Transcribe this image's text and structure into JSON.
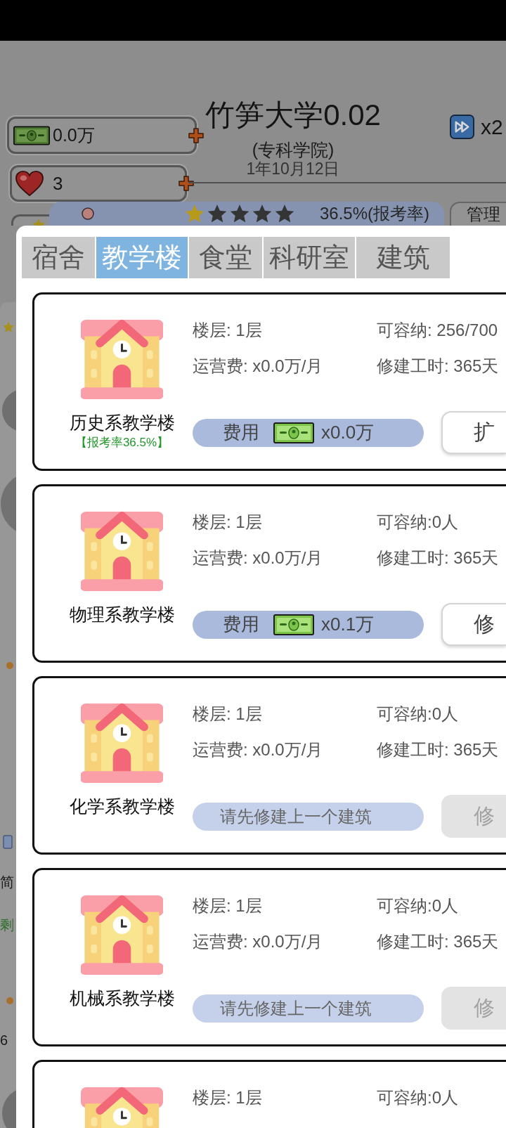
{
  "header": {
    "money": "0.0万",
    "hearts": "3",
    "title": "竹笋大学0.02",
    "subtitle": "(专科学院)",
    "date": "1年10月12日",
    "speed": "x2"
  },
  "rating_bar": {
    "stars": 1,
    "rate": "36.5%(报考率)"
  },
  "manage_button": {
    "label": "管理"
  },
  "left_strip": {
    "texts": [
      {
        "text": "简",
        "kind": "plain"
      },
      {
        "text": "剩",
        "kind": "highlight"
      },
      {
        "text": "6",
        "kind": "plain"
      }
    ]
  },
  "dialog": {
    "tabs": [
      {
        "label": "宿舍",
        "selected": false
      },
      {
        "label": "教学楼",
        "selected": true
      },
      {
        "label": "食堂",
        "selected": false
      },
      {
        "label": "科研室",
        "selected": false
      },
      {
        "label": "建筑",
        "selected": false
      }
    ],
    "buildings": [
      {
        "name": "历史系教学楼",
        "note": "【报考率36.5%】",
        "floors": "楼层: 1层",
        "capacity": "可容纳: 256/700",
        "upkeep": "运营费: x0.0万/月",
        "build_time": "修建工时: 365天",
        "cost": {
          "kind": "price",
          "label": "费用",
          "amount": "x0.0万"
        },
        "button": {
          "label": "扩",
          "disabled": false
        }
      },
      {
        "name": "物理系教学楼",
        "floors": "楼层: 1层",
        "capacity": "可容纳:0人",
        "upkeep": "运营费: x0.0万/月",
        "build_time": "修建工时: 365天",
        "cost": {
          "kind": "price",
          "label": "费用",
          "amount": "x0.1万"
        },
        "button": {
          "label": "修",
          "disabled": false
        }
      },
      {
        "name": "化学系教学楼",
        "floors": "楼层: 1层",
        "capacity": "可容纳:0人",
        "upkeep": "运营费: x0.0万/月",
        "build_time": "修建工时: 365天",
        "cost": {
          "kind": "locked",
          "message": "请先修建上一个建筑"
        },
        "button": {
          "label": "修",
          "disabled": true
        }
      },
      {
        "name": "机械系教学楼",
        "floors": "楼层: 1层",
        "capacity": "可容纳:0人",
        "upkeep": "运营费: x0.0万/月",
        "build_time": "修建工时: 365天",
        "cost": {
          "kind": "locked",
          "message": "请先修建上一个建筑"
        },
        "button": {
          "label": "修",
          "disabled": true
        }
      },
      {
        "floors": "楼层: 1层",
        "capacity": "可容纳:0人"
      }
    ]
  }
}
